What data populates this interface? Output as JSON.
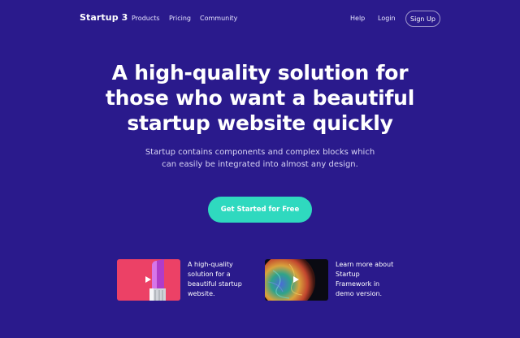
{
  "nav": {
    "logo": "Startup 3",
    "links": [
      "Products",
      "Pricing",
      "Community"
    ],
    "right_links": [
      "Help",
      "Login"
    ],
    "signup_label": "Sign Up"
  },
  "hero": {
    "title_lines": [
      "A high-quality solution for",
      "those who want a beautiful",
      "startup website quickly"
    ],
    "subtitle_lines": [
      "Startup contains components and complex blocks which",
      "can easily be integrated into almost any design."
    ],
    "cta_label": "Get Started for Free"
  },
  "cards": [
    {
      "thumb": "lipstick-image",
      "text_lines": [
        "A high-quality",
        "solution for a",
        "beautiful startup",
        "website."
      ]
    },
    {
      "thumb": "planet-image",
      "text_lines": [
        "Learn more about",
        "Startup",
        "Framework in",
        "demo version."
      ]
    }
  ],
  "colors": {
    "background": "#2a1a8c",
    "cta": "#2fd9bf",
    "card1_thumb": "#f0456a",
    "card2_thumb": "#0a0a12"
  },
  "icons": [
    "play-icon"
  ]
}
